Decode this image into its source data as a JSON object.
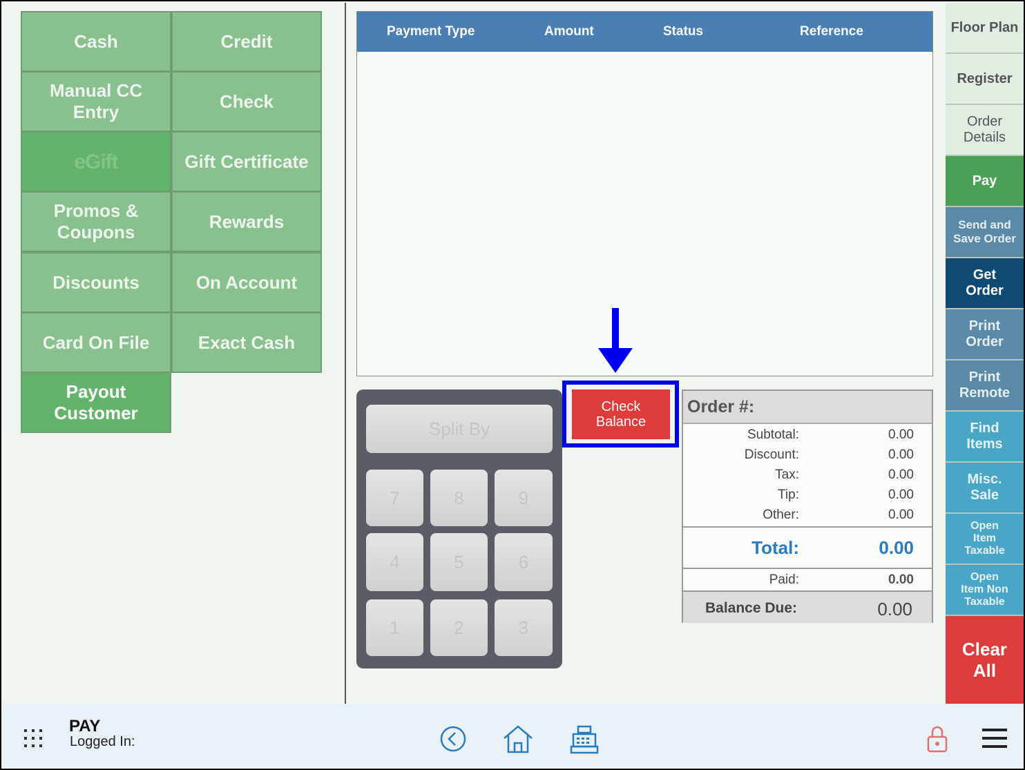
{
  "payment_methods": {
    "cash": "Cash",
    "credit": "Credit",
    "manual_cc": "Manual CC Entry",
    "check": "Check",
    "egift": "eGift",
    "gift_certificate": "Gift Certificate",
    "promos": "Promos & Coupons",
    "rewards": "Rewards",
    "discounts": "Discounts",
    "on_account": "On Account",
    "card_on_file": "Card On File",
    "exact_cash": "Exact Cash",
    "payout": "Payout Customer"
  },
  "payments_table": {
    "columns": [
      "Payment Type",
      "Amount",
      "Status",
      "Reference"
    ],
    "rows": []
  },
  "keypad": {
    "split_by": "Split By",
    "keys": [
      "7",
      "8",
      "9",
      "4",
      "5",
      "6",
      "1",
      "2",
      "3"
    ]
  },
  "check_balance": "Check Balance",
  "order": {
    "title": "Order #:",
    "subtotal_label": "Subtotal:",
    "subtotal": "0.00",
    "discount_label": "Discount:",
    "discount": "0.00",
    "tax_label": "Tax:",
    "tax": "0.00",
    "tip_label": "Tip:",
    "tip": "0.00",
    "other_label": "Other:",
    "other": "0.00",
    "total_label": "Total:",
    "total": "0.00",
    "paid_label": "Paid:",
    "paid": "0.00",
    "balance_label": "Balance Due:",
    "balance": "0.00"
  },
  "nav": {
    "floor_plan": "Floor Plan",
    "register": "Register",
    "order_details": "Order Details",
    "pay": "Pay",
    "send_save": "Send and Save Order",
    "get_order": "Get Order",
    "print_order": "Print Order",
    "print_remote": "Print Remote",
    "find_items": "Find Items",
    "misc_sale": "Misc. Sale",
    "open_taxable": "Open Item Taxable",
    "open_non_taxable": "Open Item Non Taxable",
    "clear_all": "Clear All"
  },
  "status": {
    "page": "PAY",
    "logged_in": "Logged In:"
  },
  "colors": {
    "tile": "#88c08e",
    "tile_active": "#63b36a",
    "header_blue": "#4a7fb5",
    "check_balance_red": "#de3b3b",
    "highlight_blue": "#0000ee",
    "total_blue": "#2a7bbd"
  },
  "icons": [
    "apps-grid-icon",
    "back-circle-icon",
    "home-icon",
    "cash-register-icon",
    "lock-icon",
    "menu-icon",
    "arrow-down-icon"
  ]
}
